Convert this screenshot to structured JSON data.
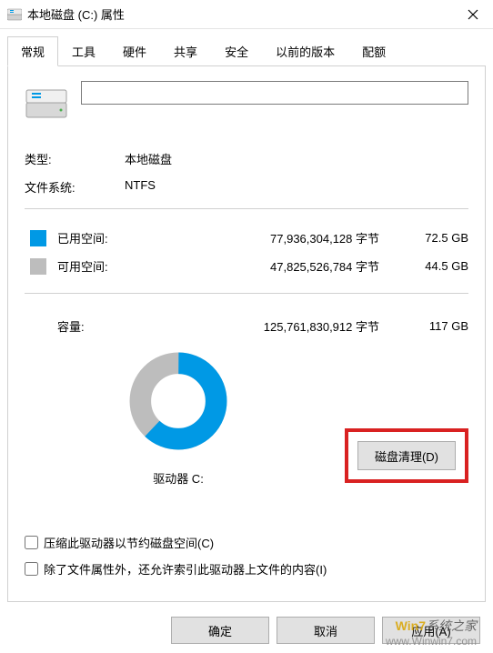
{
  "titlebar": {
    "title": "本地磁盘 (C:) 属性"
  },
  "tabs": [
    {
      "label": "常规",
      "active": true
    },
    {
      "label": "工具",
      "active": false
    },
    {
      "label": "硬件",
      "active": false
    },
    {
      "label": "共享",
      "active": false
    },
    {
      "label": "安全",
      "active": false
    },
    {
      "label": "以前的版本",
      "active": false
    },
    {
      "label": "配额",
      "active": false
    }
  ],
  "drive": {
    "label_value": "",
    "type_label": "类型:",
    "type_value": "本地磁盘",
    "fs_label": "文件系统:",
    "fs_value": "NTFS"
  },
  "space": {
    "used_label": "已用空间:",
    "used_bytes": "77,936,304,128 字节",
    "used_gb": "72.5 GB",
    "free_label": "可用空间:",
    "free_bytes": "47,825,526,784 字节",
    "free_gb": "44.5 GB",
    "cap_label": "容量:",
    "cap_bytes": "125,761,830,912 字节",
    "cap_gb": "117 GB"
  },
  "colors": {
    "used": "#0099e5",
    "free": "#bdbdbd"
  },
  "chart_data": {
    "type": "pie",
    "title": "驱动器 C:",
    "series": [
      {
        "name": "已用空间",
        "value": 72.5,
        "color": "#0099e5"
      },
      {
        "name": "可用空间",
        "value": 44.5,
        "color": "#bdbdbd"
      }
    ],
    "total": 117,
    "unit": "GB"
  },
  "drive_letter_label": "驱动器 C:",
  "cleanup_label": "磁盘清理(D)",
  "compress_label": "压缩此驱动器以节约磁盘空间(C)",
  "index_label": "除了文件属性外，还允许索引此驱动器上文件的内容(I)",
  "buttons": {
    "ok": "确定",
    "cancel": "取消",
    "apply": "应用(A)"
  },
  "watermark": {
    "line1a": "Win7",
    "line1b": "系统之家",
    "line2": "www.Winwin7.com"
  }
}
